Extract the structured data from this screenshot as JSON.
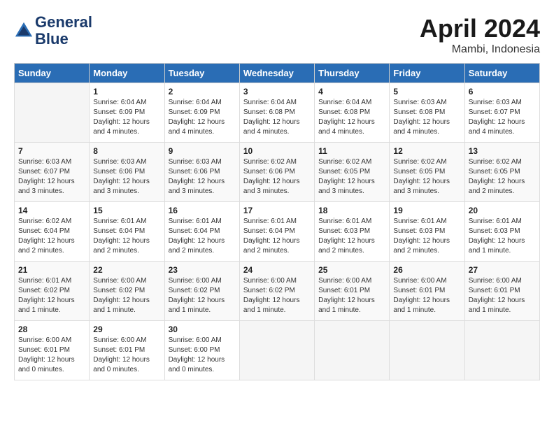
{
  "header": {
    "logo_line1": "General",
    "logo_line2": "Blue",
    "month": "April 2024",
    "location": "Mambi, Indonesia"
  },
  "days_of_week": [
    "Sunday",
    "Monday",
    "Tuesday",
    "Wednesday",
    "Thursday",
    "Friday",
    "Saturday"
  ],
  "weeks": [
    [
      {
        "day": "",
        "info": ""
      },
      {
        "day": "1",
        "info": "Sunrise: 6:04 AM\nSunset: 6:09 PM\nDaylight: 12 hours\nand 4 minutes."
      },
      {
        "day": "2",
        "info": "Sunrise: 6:04 AM\nSunset: 6:09 PM\nDaylight: 12 hours\nand 4 minutes."
      },
      {
        "day": "3",
        "info": "Sunrise: 6:04 AM\nSunset: 6:08 PM\nDaylight: 12 hours\nand 4 minutes."
      },
      {
        "day": "4",
        "info": "Sunrise: 6:04 AM\nSunset: 6:08 PM\nDaylight: 12 hours\nand 4 minutes."
      },
      {
        "day": "5",
        "info": "Sunrise: 6:03 AM\nSunset: 6:08 PM\nDaylight: 12 hours\nand 4 minutes."
      },
      {
        "day": "6",
        "info": "Sunrise: 6:03 AM\nSunset: 6:07 PM\nDaylight: 12 hours\nand 4 minutes."
      }
    ],
    [
      {
        "day": "7",
        "info": "Sunrise: 6:03 AM\nSunset: 6:07 PM\nDaylight: 12 hours\nand 3 minutes."
      },
      {
        "day": "8",
        "info": "Sunrise: 6:03 AM\nSunset: 6:06 PM\nDaylight: 12 hours\nand 3 minutes."
      },
      {
        "day": "9",
        "info": "Sunrise: 6:03 AM\nSunset: 6:06 PM\nDaylight: 12 hours\nand 3 minutes."
      },
      {
        "day": "10",
        "info": "Sunrise: 6:02 AM\nSunset: 6:06 PM\nDaylight: 12 hours\nand 3 minutes."
      },
      {
        "day": "11",
        "info": "Sunrise: 6:02 AM\nSunset: 6:05 PM\nDaylight: 12 hours\nand 3 minutes."
      },
      {
        "day": "12",
        "info": "Sunrise: 6:02 AM\nSunset: 6:05 PM\nDaylight: 12 hours\nand 3 minutes."
      },
      {
        "day": "13",
        "info": "Sunrise: 6:02 AM\nSunset: 6:05 PM\nDaylight: 12 hours\nand 2 minutes."
      }
    ],
    [
      {
        "day": "14",
        "info": "Sunrise: 6:02 AM\nSunset: 6:04 PM\nDaylight: 12 hours\nand 2 minutes."
      },
      {
        "day": "15",
        "info": "Sunrise: 6:01 AM\nSunset: 6:04 PM\nDaylight: 12 hours\nand 2 minutes."
      },
      {
        "day": "16",
        "info": "Sunrise: 6:01 AM\nSunset: 6:04 PM\nDaylight: 12 hours\nand 2 minutes."
      },
      {
        "day": "17",
        "info": "Sunrise: 6:01 AM\nSunset: 6:04 PM\nDaylight: 12 hours\nand 2 minutes."
      },
      {
        "day": "18",
        "info": "Sunrise: 6:01 AM\nSunset: 6:03 PM\nDaylight: 12 hours\nand 2 minutes."
      },
      {
        "day": "19",
        "info": "Sunrise: 6:01 AM\nSunset: 6:03 PM\nDaylight: 12 hours\nand 2 minutes."
      },
      {
        "day": "20",
        "info": "Sunrise: 6:01 AM\nSunset: 6:03 PM\nDaylight: 12 hours\nand 1 minute."
      }
    ],
    [
      {
        "day": "21",
        "info": "Sunrise: 6:01 AM\nSunset: 6:02 PM\nDaylight: 12 hours\nand 1 minute."
      },
      {
        "day": "22",
        "info": "Sunrise: 6:00 AM\nSunset: 6:02 PM\nDaylight: 12 hours\nand 1 minute."
      },
      {
        "day": "23",
        "info": "Sunrise: 6:00 AM\nSunset: 6:02 PM\nDaylight: 12 hours\nand 1 minute."
      },
      {
        "day": "24",
        "info": "Sunrise: 6:00 AM\nSunset: 6:02 PM\nDaylight: 12 hours\nand 1 minute."
      },
      {
        "day": "25",
        "info": "Sunrise: 6:00 AM\nSunset: 6:01 PM\nDaylight: 12 hours\nand 1 minute."
      },
      {
        "day": "26",
        "info": "Sunrise: 6:00 AM\nSunset: 6:01 PM\nDaylight: 12 hours\nand 1 minute."
      },
      {
        "day": "27",
        "info": "Sunrise: 6:00 AM\nSunset: 6:01 PM\nDaylight: 12 hours\nand 1 minute."
      }
    ],
    [
      {
        "day": "28",
        "info": "Sunrise: 6:00 AM\nSunset: 6:01 PM\nDaylight: 12 hours\nand 0 minutes."
      },
      {
        "day": "29",
        "info": "Sunrise: 6:00 AM\nSunset: 6:01 PM\nDaylight: 12 hours\nand 0 minutes."
      },
      {
        "day": "30",
        "info": "Sunrise: 6:00 AM\nSunset: 6:00 PM\nDaylight: 12 hours\nand 0 minutes."
      },
      {
        "day": "",
        "info": ""
      },
      {
        "day": "",
        "info": ""
      },
      {
        "day": "",
        "info": ""
      },
      {
        "day": "",
        "info": ""
      }
    ]
  ]
}
